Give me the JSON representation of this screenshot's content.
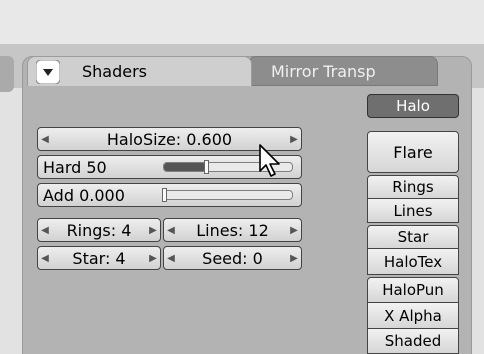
{
  "tabs": {
    "active": "Shaders",
    "inactive": "Mirror Transp"
  },
  "halo_button": "Halo",
  "halo_size": {
    "label": "HaloSize: 0.600",
    "value": 0.6
  },
  "hard": {
    "label": "Hard 50",
    "value": 50,
    "fill_fraction": 0.33
  },
  "add": {
    "label": "Add  0.000",
    "value": 0.0,
    "fill_fraction": 0.0
  },
  "rings": {
    "label": "Rings: 4",
    "value": 4
  },
  "lines": {
    "label": "Lines: 12",
    "value": 12
  },
  "star": {
    "label": "Star: 4",
    "value": 4
  },
  "seed": {
    "label": "Seed: 0",
    "value": 0
  },
  "toggles": {
    "flare": "Flare",
    "rings": "Rings",
    "lines": "Lines",
    "star": "Star",
    "halotex": "HaloTex",
    "halopun": "HaloPun",
    "xalpha": "X Alpha",
    "shaded": "Shaded"
  },
  "colors": {
    "panel": "#b3b3b3",
    "active_toggle": "#6f6f6f",
    "button": "#e0e0e0"
  },
  "icons": {
    "collapse": "triangle-down-icon",
    "cursor": "mouse-pointer-icon",
    "decrement": "arrow-left-icon",
    "increment": "arrow-right-icon"
  }
}
